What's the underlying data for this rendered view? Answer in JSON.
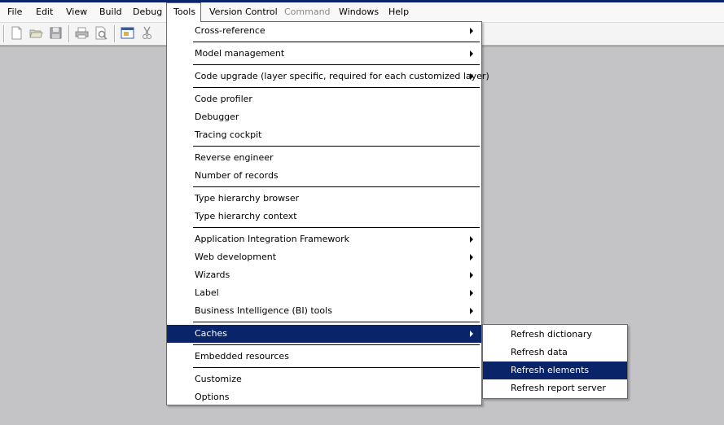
{
  "menubar": {
    "items": [
      {
        "label": "File"
      },
      {
        "label": "Edit"
      },
      {
        "label": "View"
      },
      {
        "label": "Build"
      },
      {
        "label": "Debug"
      },
      {
        "label": "Tools"
      },
      {
        "label": "Version Control"
      },
      {
        "label": "Command"
      },
      {
        "label": "Windows"
      },
      {
        "label": "Help"
      }
    ],
    "open_menu": "Tools",
    "disabled_item": "Command"
  },
  "toolbar": {
    "icons": [
      "new-document-icon",
      "open-folder-icon",
      "save-icon",
      "print-icon",
      "print-preview-icon",
      "properties-icon",
      "cut-icon"
    ]
  },
  "tools_menu": {
    "items": [
      {
        "label": "Cross-reference",
        "submenu": true
      },
      {
        "label": "Model management",
        "submenu": true
      },
      {
        "label": "Code upgrade (layer specific, required for each customized layer)",
        "submenu": true
      },
      {
        "label": "Code profiler",
        "submenu": false
      },
      {
        "label": "Debugger",
        "submenu": false
      },
      {
        "label": "Tracing cockpit",
        "submenu": false
      },
      {
        "label": "Reverse engineer",
        "submenu": false
      },
      {
        "label": "Number of records",
        "submenu": false
      },
      {
        "label": "Type hierarchy browser",
        "submenu": false
      },
      {
        "label": "Type hierarchy context",
        "submenu": false
      },
      {
        "label": "Application Integration Framework",
        "submenu": true
      },
      {
        "label": "Web development",
        "submenu": true
      },
      {
        "label": "Wizards",
        "submenu": true
      },
      {
        "label": "Label",
        "submenu": true
      },
      {
        "label": "Business Intelligence (BI) tools",
        "submenu": true
      },
      {
        "label": "Caches",
        "submenu": true,
        "selected": true
      },
      {
        "label": "Embedded resources",
        "submenu": false
      },
      {
        "label": "Customize",
        "submenu": false
      },
      {
        "label": "Options",
        "submenu": false
      }
    ]
  },
  "caches_submenu": {
    "items": [
      {
        "label": "Refresh dictionary"
      },
      {
        "label": "Refresh data"
      },
      {
        "label": "Refresh elements",
        "selected": true
      },
      {
        "label": "Refresh report server"
      }
    ]
  },
  "colors": {
    "highlight": "#0a246a",
    "workspace": "#c4c3c6"
  }
}
